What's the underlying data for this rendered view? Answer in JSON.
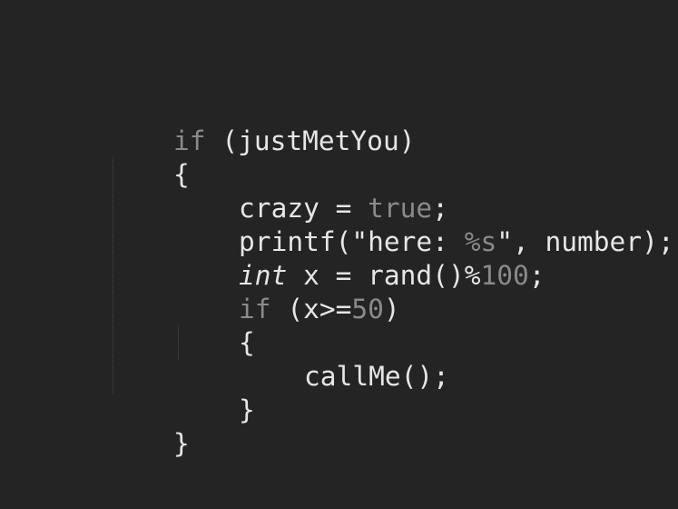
{
  "code": {
    "lines": [
      [
        {
          "t": "if",
          "c": "kw"
        },
        {
          "t": " (justMetYou)"
        }
      ],
      [
        {
          "t": "{"
        }
      ],
      [
        {
          "t": "crazy = "
        },
        {
          "t": "true",
          "c": "kw"
        },
        {
          "t": ";"
        }
      ],
      [
        {
          "t": "printf(\"here: "
        },
        {
          "t": "%s",
          "c": "fmt"
        },
        {
          "t": "\", number);"
        }
      ],
      [
        {
          "t": "int",
          "c": "type"
        },
        {
          "t": " x = rand()%"
        },
        {
          "t": "100",
          "c": "num"
        },
        {
          "t": ";"
        }
      ],
      [
        {
          "t": "if",
          "c": "kw"
        },
        {
          "t": " (x>="
        },
        {
          "t": "50",
          "c": "num"
        },
        {
          "t": ")"
        }
      ],
      [
        {
          "t": "{"
        }
      ],
      [
        {
          "t": "callMe();"
        }
      ],
      [
        {
          "t": "}"
        }
      ],
      [
        {
          "t": "}"
        }
      ]
    ]
  }
}
